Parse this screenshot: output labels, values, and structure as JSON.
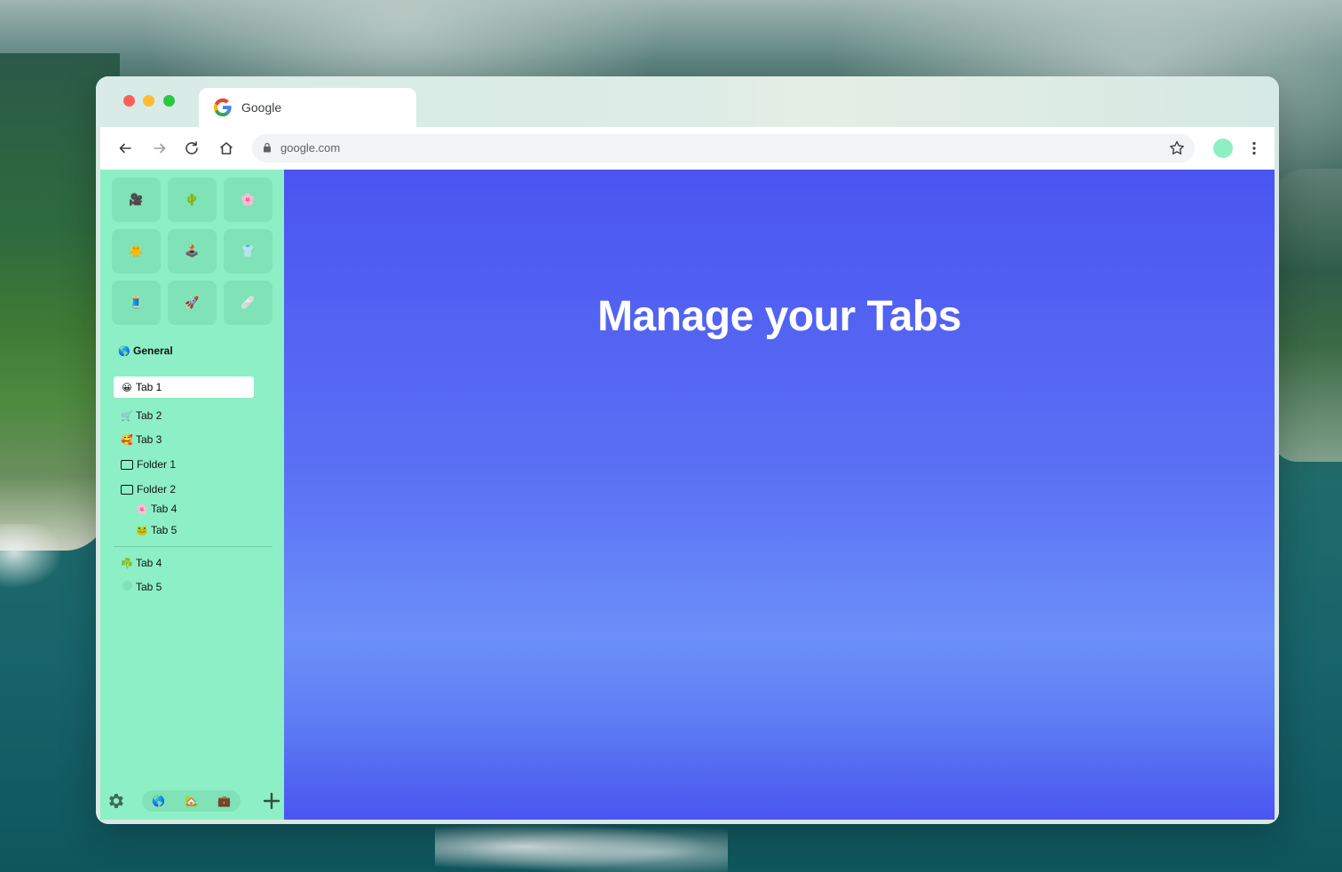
{
  "browser": {
    "tab_title": "Google",
    "url": "google.com"
  },
  "favorites": [
    "🎥",
    "🌵",
    "🌸",
    "🐥",
    "🕹️",
    "👕",
    "🧵",
    "🚀",
    "🩹"
  ],
  "sidebar": {
    "space": {
      "emoji": "🌎",
      "label": "General"
    },
    "active_tab": {
      "emoji": "😀",
      "label": "Tab 1"
    },
    "tabs": [
      {
        "emoji": "🛒",
        "label": "Tab 2"
      },
      {
        "emoji": "🥰",
        "label": "Tab 3"
      }
    ],
    "folders": [
      {
        "label": "Folder 1"
      },
      {
        "label": "Folder 2",
        "children": [
          {
            "emoji": "🌸",
            "label": "Tab 4"
          },
          {
            "emoji": "🐸",
            "label": "Tab 5"
          }
        ]
      }
    ],
    "unpinned": [
      {
        "emoji": "☘️",
        "label": "Tab 4"
      },
      {
        "emoji": "",
        "label": "Tab 5"
      }
    ],
    "space_switcher": [
      "🌎",
      "🏡",
      "💼"
    ]
  },
  "content": {
    "headline": "Manage your Tabs"
  },
  "colors": {
    "sidebar": "#8defc5",
    "content": "#4a55f0",
    "profile": "#8df0c3"
  }
}
